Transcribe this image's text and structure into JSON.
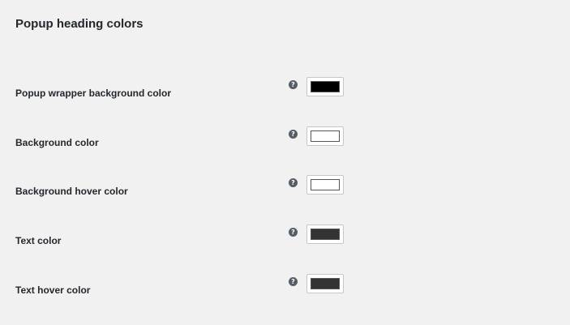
{
  "section": {
    "title": "Popup heading colors"
  },
  "help_glyph": "?",
  "rows": [
    {
      "label": "Popup wrapper background color",
      "color": "#000000"
    },
    {
      "label": "Background color",
      "color": "#ffffff"
    },
    {
      "label": "Background hover color",
      "color": "#ffffff"
    },
    {
      "label": "Text color",
      "color": "#333333"
    },
    {
      "label": "Text hover color",
      "color": "#333333"
    }
  ]
}
